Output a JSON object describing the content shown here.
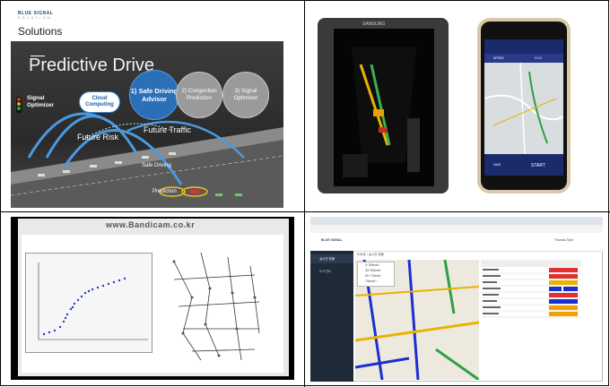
{
  "panel1": {
    "brand": "BLUE SIGNAL",
    "brand_sub": "S O L U T I O N",
    "heading": "Solutions",
    "title": "Predictive Drive",
    "circles": [
      {
        "label": "1) Safe Driving Advisor"
      },
      {
        "label": "2) Congestion Prediction"
      },
      {
        "label": "3) Signal Optimizer"
      }
    ],
    "signal_optimizer": "Signal Optimizer",
    "cloud": "Cloud Computing",
    "future_risk": "Future Risk",
    "future_traffic": "Future Traffic",
    "safe_driving": "Safe Driving",
    "prediction": "Prediction"
  },
  "panel2": {
    "phone1_brand": "SAMSUNG",
    "phone2_tabs": [
      "SPEED",
      "RISK"
    ],
    "phone2_buttons": [
      "HIDE",
      "START"
    ]
  },
  "panel3": {
    "watermark": "www.Bandicam.co.kr"
  },
  "panel4": {
    "app_name": "BLUE SIGNAL",
    "user": "Thomas Tyler",
    "menu": [
      "실시간 현황",
      "도구관리"
    ],
    "breadcrumb": "도로상 › 실시간 현황",
    "legend": [
      "0~30km/h",
      "30~50km/h",
      "50~70km/h",
      "70km/h~"
    ],
    "table_rows": 8
  },
  "colors": {
    "accent_blue": "#2b6fb7",
    "dark_side": "#1e2a38",
    "road_green": "#2ea043",
    "road_yellow": "#e8b400",
    "road_blue": "#1a2fd0"
  }
}
